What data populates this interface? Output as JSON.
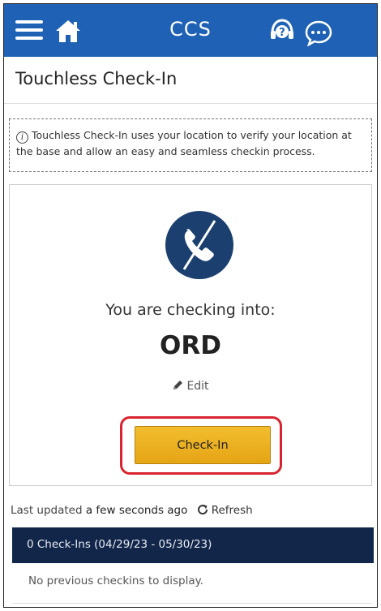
{
  "header": {
    "app_title": "CCS",
    "icons": [
      "hamburger-menu-icon",
      "home-icon",
      "help-headset-icon",
      "chat-bubble-icon"
    ],
    "color": "#1f62b5"
  },
  "page": {
    "title": "Touchless Check-In"
  },
  "info": {
    "icon": "info-icon",
    "text": "Touchless Check-In uses your location to verify your location at the base and allow an easy and seamless checkin process."
  },
  "checkin_card": {
    "logo_icon": "phone-slash-icon",
    "checking_label": "You are checking into:",
    "location_code": "ORD",
    "edit_label": "Edit",
    "button_label": "Check-In",
    "button_color": "#f0b429",
    "highlight_color": "#d9232f"
  },
  "status": {
    "prefix": "Last updated",
    "age": "a few seconds ago",
    "refresh_label": "Refresh"
  },
  "checkins": {
    "header": "0 Check-Ins (04/29/23 - 05/30/23)",
    "header_color": "#12264a",
    "empty_message": "No previous checkins to display."
  }
}
